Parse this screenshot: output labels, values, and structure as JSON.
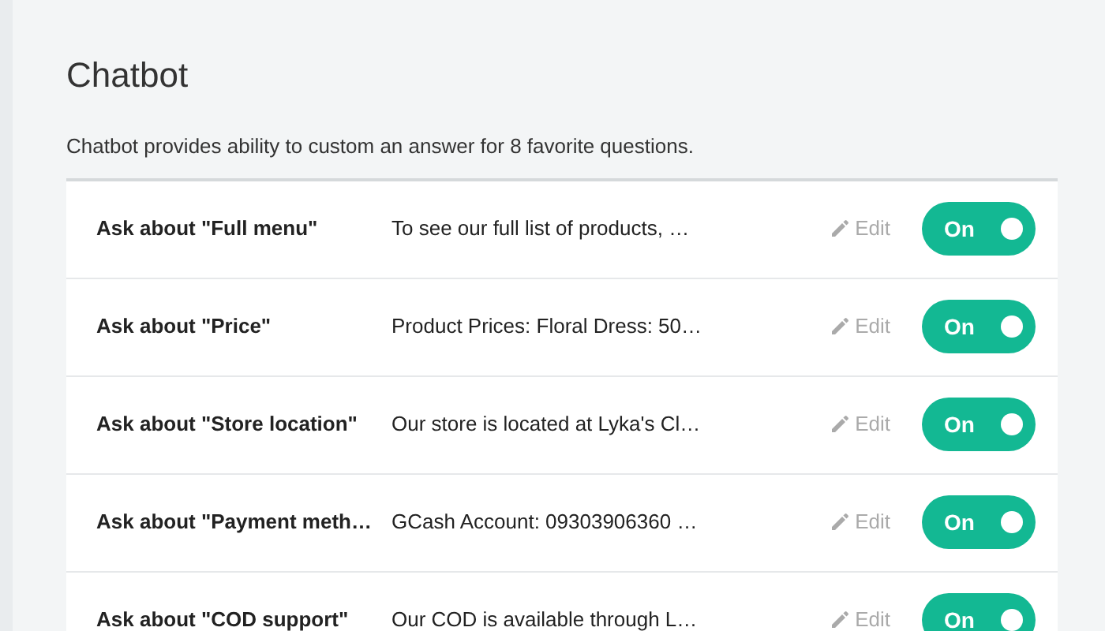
{
  "page": {
    "title": "Chatbot",
    "description": "Chatbot provides ability to custom an answer for 8 favorite questions."
  },
  "questions": [
    {
      "question": "Ask about \"Full menu\"",
      "answer": "To see our full list of products, …",
      "edit": "Edit",
      "on": true,
      "toggle_label": "On"
    },
    {
      "question": "Ask about \"Price\"",
      "answer": "Product Prices: Floral Dress: 50…",
      "edit": "Edit",
      "on": true,
      "toggle_label": "On"
    },
    {
      "question": "Ask about \"Store location\"",
      "answer": "Our store is located at Lyka's Cl…",
      "edit": "Edit",
      "on": true,
      "toggle_label": "On"
    },
    {
      "question": "Ask about \"Payment meth…",
      "answer": "GCash Account: 09303906360 …",
      "edit": "Edit",
      "on": true,
      "toggle_label": "On"
    },
    {
      "question": "Ask about \"COD support\"",
      "answer": "Our COD is available through L…",
      "edit": "Edit",
      "on": true,
      "toggle_label": "On"
    }
  ]
}
